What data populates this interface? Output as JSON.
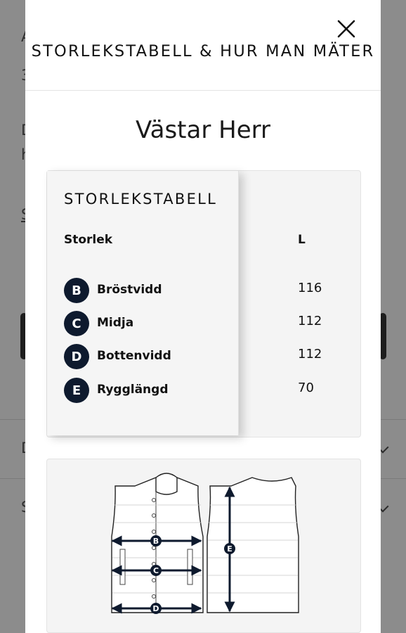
{
  "background": {
    "text_1": "A",
    "text_2": "3",
    "text_3": "D",
    "text_4": "h",
    "text_5": "S",
    "text_6": "D",
    "text_7": "S"
  },
  "modal": {
    "title": "STORLEKSTABELL & HUR MAN MÄTER",
    "close_icon": "close-icon",
    "product_heading": "Västar Herr"
  },
  "size_table": {
    "title": "STORLEKSTABELL",
    "column_header": "Storlek",
    "size_header": "L",
    "rows": [
      {
        "badge": "B",
        "label": "Bröstvidd",
        "value": "116"
      },
      {
        "badge": "C",
        "label": "Midja",
        "value": "112"
      },
      {
        "badge": "D",
        "label": "Bottenvidd",
        "value": "112"
      },
      {
        "badge": "E",
        "label": "Rygglängd",
        "value": "70"
      }
    ]
  },
  "illustration": {
    "markers": [
      "B",
      "C",
      "D",
      "E"
    ],
    "accent_color": "#0e1a2e"
  }
}
